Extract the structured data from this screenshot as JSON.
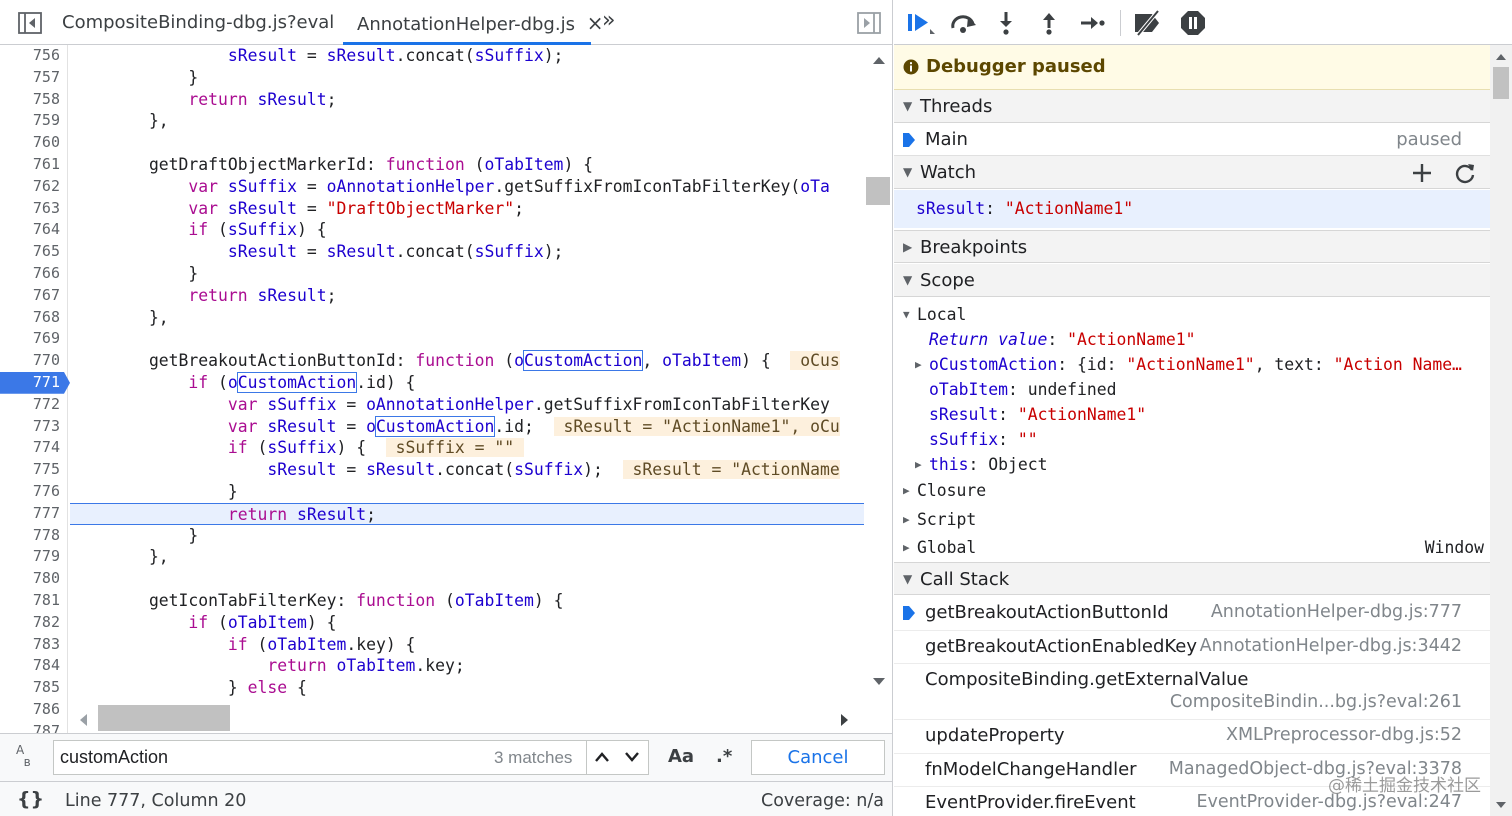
{
  "tabs": {
    "file1": "CompositeBinding-dbg.js?eval",
    "file2": "AnnotationHelper-dbg.js",
    "close": "×",
    "more": "»"
  },
  "code": {
    "lines": [
      {
        "n": "756",
        "html": "        <span class=\"v\">sResult</span> = <span class=\"v\">sResult</span>.concat(<span class=\"v\">sSuffix</span>);"
      },
      {
        "n": "757",
        "html": "    }"
      },
      {
        "n": "758",
        "html": "    <span class=\"kw\">return</span> <span class=\"v\">sResult</span>;"
      },
      {
        "n": "759",
        "html": "},"
      },
      {
        "n": "760",
        "html": ""
      },
      {
        "n": "761",
        "html": "getDraftObjectMarkerId: <span class=\"kw\">function</span> (<span class=\"v\">oTabItem</span>) {"
      },
      {
        "n": "762",
        "html": "    <span class=\"kw\">var</span> <span class=\"v\">sSuffix</span> = <span class=\"v\">oAnnotationHelper</span>.getSuffixFromIconTabFilterKey(<span class=\"v\">oTa</span>"
      },
      {
        "n": "763",
        "html": "    <span class=\"kw\">var</span> <span class=\"v\">sResult</span> = <span class=\"s\">\"DraftObjectMarker\"</span>;"
      },
      {
        "n": "764",
        "html": "    <span class=\"kw\">if</span> (<span class=\"v\">sSuffix</span>) {"
      },
      {
        "n": "765",
        "html": "        <span class=\"v\">sResult</span> = <span class=\"v\">sResult</span>.concat(<span class=\"v\">sSuffix</span>);"
      },
      {
        "n": "766",
        "html": "    }"
      },
      {
        "n": "767",
        "html": "    <span class=\"kw\">return</span> <span class=\"v\">sResult</span>;"
      },
      {
        "n": "768",
        "html": "},"
      },
      {
        "n": "769",
        "html": ""
      },
      {
        "n": "770",
        "html": "getBreakoutActionButtonId: <span class=\"kw\">function</span> (<span class=\"v\">o<span class=\"hl\">CustomAction</span></span>, <span class=\"v\">oTabItem</span>) {  <span class=\"inl\"> oCus</span>"
      },
      {
        "n": "771",
        "html": "    <span class=\"kw\">if</span> (<span class=\"v\">o<span class=\"hl\">CustomAction</span></span>.id) {"
      },
      {
        "n": "772",
        "html": "        <span class=\"kw\">var</span> <span class=\"v\">sSuffix</span> = <span class=\"v\">oAnnotationHelper</span>.getSuffixFromIconTabFilterKey"
      },
      {
        "n": "773",
        "html": "        <span class=\"kw\">var</span> <span class=\"v\">sResult</span> = <span class=\"v\">o<span class=\"hl\">CustomAction</span></span>.id;  <span class=\"inl\"> sResult = \"ActionName1\", oCu</span>"
      },
      {
        "n": "774",
        "html": "        <span class=\"kw\">if</span> (<span class=\"v\">sSuffix</span>) {  <span class=\"inl\"> sSuffix = \"\" </span>"
      },
      {
        "n": "775",
        "html": "            <span class=\"v\">sResult</span> = <span class=\"v\">sResult</span>.concat(<span class=\"v\">sSuffix</span>);  <span class=\"inl\"> sResult = \"ActionName</span>"
      },
      {
        "n": "776",
        "html": "        }"
      },
      {
        "n": "777",
        "html": "        <span class=\"kw\">return</span> <span class=\"v\">sResult</span>;"
      },
      {
        "n": "778",
        "html": "    }"
      },
      {
        "n": "779",
        "html": "},"
      },
      {
        "n": "780",
        "html": ""
      },
      {
        "n": "781",
        "html": "getIconTabFilterKey: <span class=\"kw\">function</span> (<span class=\"v\">oTabItem</span>) {"
      },
      {
        "n": "782",
        "html": "    <span class=\"kw\">if</span> (<span class=\"v\">oTabItem</span>) {"
      },
      {
        "n": "783",
        "html": "        <span class=\"kw\">if</span> (<span class=\"v\">oTabItem</span>.key) {"
      },
      {
        "n": "784",
        "html": "            <span class=\"kw\">return</span> <span class=\"v\">oTabItem</span>.key;"
      },
      {
        "n": "785",
        "html": "        } <span class=\"kw\">else</span> {"
      },
      {
        "n": "786",
        "html": ""
      },
      {
        "n": "787",
        "html": ""
      }
    ],
    "breakpoint_line": "771",
    "current_line": "777"
  },
  "search": {
    "value": "customAction",
    "matches": "3 matches",
    "case_label": "Aa",
    "regex_label": ".*",
    "cancel": "Cancel"
  },
  "status": {
    "position": "Line 777, Column 20",
    "coverage": "Coverage: n/a",
    "format_icon": "{}"
  },
  "debugger": {
    "paused_text": "Debugger paused",
    "threads": {
      "title": "Threads",
      "main": "Main",
      "state": "paused"
    },
    "watch": {
      "title": "Watch",
      "expr_name": "sResult",
      "expr_value": "\"ActionName1\""
    },
    "breakpoints": {
      "title": "Breakpoints"
    },
    "scope": {
      "title": "Scope",
      "local": "Local",
      "items": [
        {
          "name": "Return value",
          "value": "\"ActionName1\"",
          "vclass": "s",
          "italic": true,
          "expand": false
        },
        {
          "name": "oCustomAction",
          "value": "{id: <span class=\"s\">\"ActionName1\"</span>, text: <span class=\"s\">\"Action Name…</span>",
          "vclass": "",
          "italic": false,
          "expand": true
        },
        {
          "name": "oTabItem",
          "value": "undefined",
          "vclass": "plain",
          "italic": false,
          "expand": false
        },
        {
          "name": "sResult",
          "value": "\"ActionName1\"",
          "vclass": "s",
          "italic": false,
          "expand": false
        },
        {
          "name": "sSuffix",
          "value": "\"\"",
          "vclass": "s",
          "italic": false,
          "expand": false
        }
      ],
      "this_name": "this",
      "this_value": "Object",
      "closure": "Closure",
      "script": "Script",
      "global": "Global",
      "global_value": "Window"
    },
    "callstack": {
      "title": "Call Stack",
      "frames": [
        {
          "fn": "getBreakoutActionButtonId",
          "loc": "AnnotationHelper-dbg.js:777",
          "current": true
        },
        {
          "fn": "getBreakoutActionEnabledKey",
          "loc": "AnnotationHelper-dbg.js:3442",
          "current": false
        },
        {
          "fn": "CompositeBinding.getExternalValue",
          "loc": "CompositeBindin...bg.js?eval:261",
          "current": false,
          "wrap": true
        },
        {
          "fn": "updateProperty",
          "loc": "XMLPreprocessor-dbg.js:52",
          "current": false
        },
        {
          "fn": "fnModelChangeHandler",
          "loc": "ManagedObject-dbg.js?eval:3378",
          "current": false
        },
        {
          "fn": "EventProvider.fireEvent",
          "loc": "EventProvider-dbg.js?eval:247",
          "current": false
        }
      ]
    },
    "watermark": "@稀土掘金技术社区"
  },
  "colors": {
    "accent": "#1a73e8",
    "breakpoint": "#3b78e7",
    "keyword": "#aa0d91",
    "variable": "#1c00cf",
    "string": "#c80000",
    "paused_bg": "#fffbe6"
  }
}
